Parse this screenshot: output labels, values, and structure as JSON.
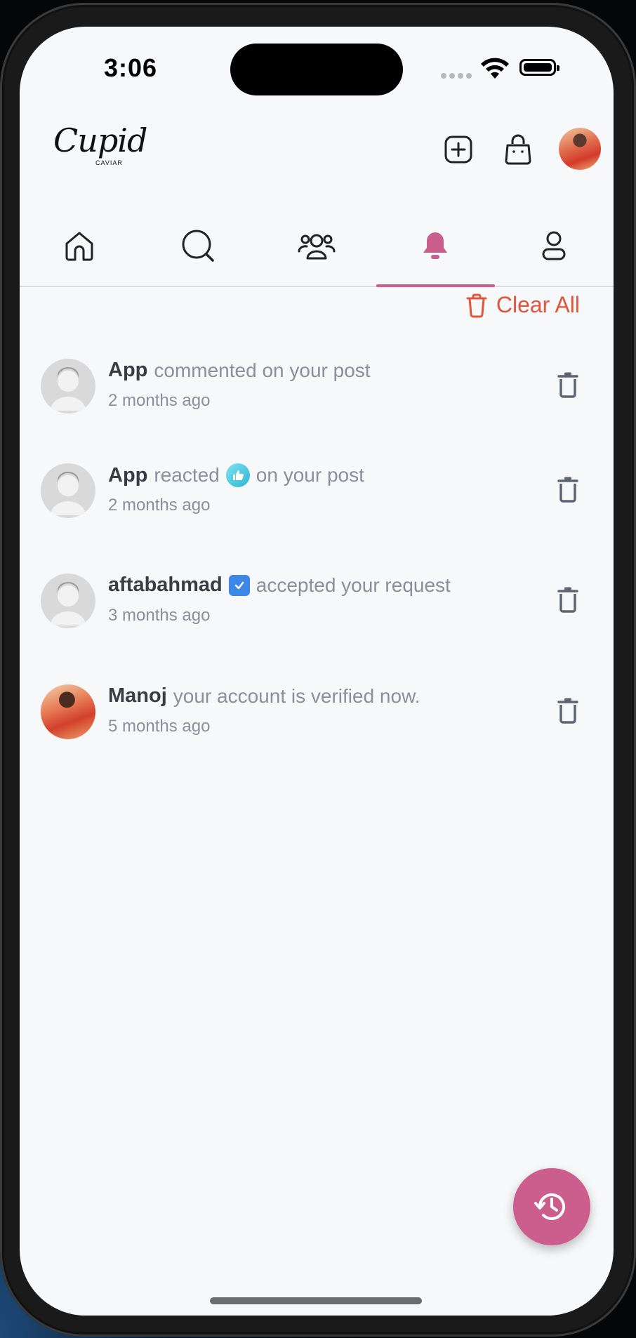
{
  "status_bar": {
    "time": "3:06"
  },
  "header": {
    "logo_text": "Cupid",
    "logo_sub": "CAVIAR",
    "icons": [
      "add-post-icon",
      "shopping-bag-icon"
    ]
  },
  "tabs": [
    {
      "name": "home",
      "icon": "home-icon",
      "active": false
    },
    {
      "name": "search",
      "icon": "search-icon",
      "active": false
    },
    {
      "name": "community",
      "icon": "community-icon",
      "active": false
    },
    {
      "name": "notifications",
      "icon": "bell-icon",
      "active": true
    },
    {
      "name": "profile",
      "icon": "profile-icon",
      "active": false
    }
  ],
  "clear_all": {
    "label": "Clear All",
    "icon": "trash-outline-icon"
  },
  "notifications": [
    {
      "name": "App",
      "pre": "commented on your post",
      "post": "",
      "time": "2 months ago",
      "extra_icon": ""
    },
    {
      "name": "App",
      "pre": "reacted",
      "post": "on your post",
      "time": "2 months ago",
      "extra_icon": "thumbs-up-reaction-icon"
    },
    {
      "name": "aftabahmad",
      "pre": "accepted your request",
      "post": "",
      "time": "3 months ago",
      "extra_icon": "verified-badge-icon"
    },
    {
      "name": "Manoj",
      "pre": "your account is verified now.",
      "post": "",
      "time": "5 months ago",
      "extra_icon": ""
    }
  ],
  "fab": {
    "icon": "history-icon"
  },
  "colors": {
    "accent": "#cc5e8e",
    "danger": "#e0563c",
    "muted_text": "#8b9098",
    "name_text": "#3a3c42",
    "background": "#f7f8fa"
  }
}
